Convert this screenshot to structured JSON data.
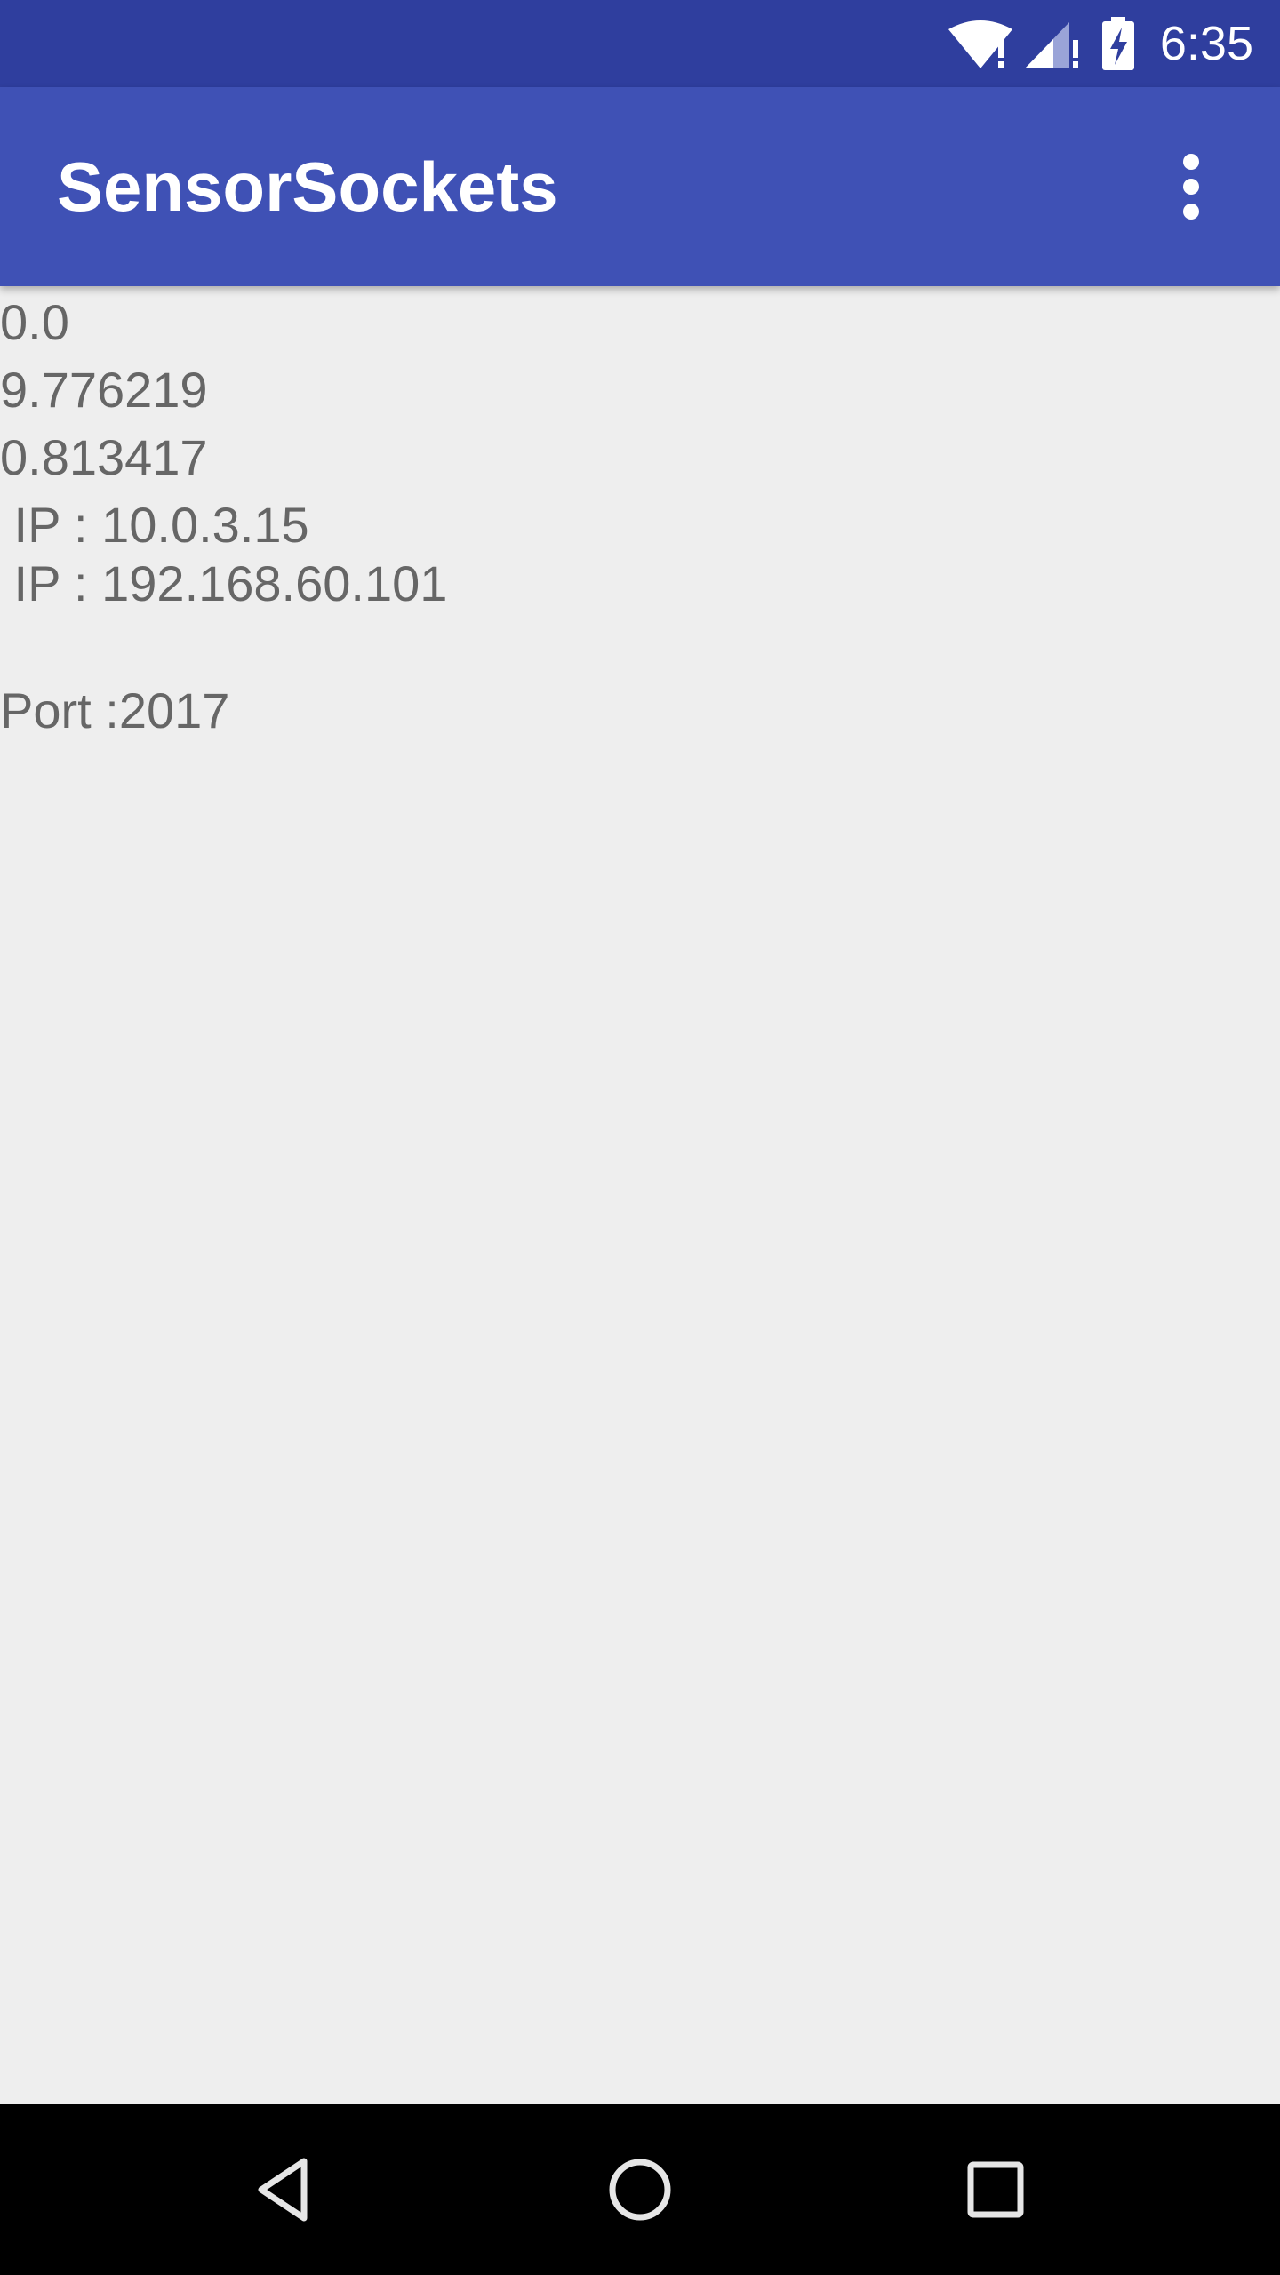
{
  "status_bar": {
    "time": "6:35",
    "icons": [
      "wifi-alert-icon",
      "cell-signal-alert-icon",
      "battery-charging-icon"
    ]
  },
  "app_bar": {
    "title": "SensorSockets",
    "overflow_icon": "more-vert-icon"
  },
  "content": {
    "sensor_values": [
      "0.0",
      "9.776219",
      "0.813417"
    ],
    "ip_lines": [
      " IP : 10.0.3.15",
      " IP : 192.168.60.101"
    ],
    "port_line": "Port :2017"
  },
  "nav_bar": {
    "icons": [
      "back-icon",
      "home-icon",
      "recents-icon"
    ]
  },
  "colors": {
    "status_bar": "#2f3e9e",
    "app_bar": "#3f51b5",
    "background": "#eeeeee",
    "text": "#666666",
    "nav_bar": "#000000"
  }
}
